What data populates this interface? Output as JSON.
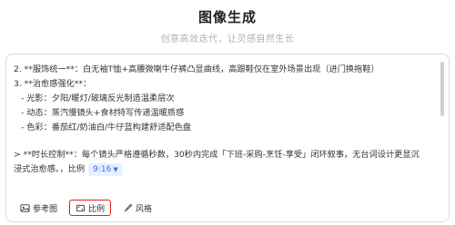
{
  "header": {
    "title": "图像生成",
    "subtitle": "创意高效迭代，让灵感自然生长"
  },
  "editor": {
    "lines": [
      "2. **服饰统一**：白无袖T恤+高腰微喇牛仔裤凸显曲线，高跟鞋仅在室外场景出现（进门换拖鞋）",
      "3. **治愈感强化**：",
      "- 光影：夕阳/暖灯/玻璃反光制造温柔层次",
      "- 动态：蒸汽慢镜头+食材特写传递温暖质感",
      "- 色彩：番茄红/奶油白/牛仔蓝构建舒适配色盘",
      "> **时长控制**：每个镜头严格遵循秒数，30秒内完成「下班-采购-烹饪-享受」闭环叙事，无台词设计更显沉",
      "浸式治愈感。，比例"
    ],
    "ratio_tag": "9:16"
  },
  "toolbar": {
    "reference_label": "参考图",
    "ratio_label": "比例",
    "style_label": "风格"
  },
  "colors": {
    "accent": "#3d6fe0",
    "highlight_border": "#e02020"
  }
}
